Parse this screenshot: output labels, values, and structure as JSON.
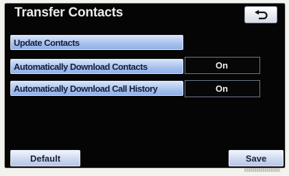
{
  "screen": {
    "title": "Transfer Contacts"
  },
  "header": {
    "back_icon": "return-arrow-icon"
  },
  "settings": {
    "update_label": "Update Contacts",
    "auto_contacts_label": "Automatically Download Contacts",
    "auto_contacts_value": "On",
    "auto_history_label": "Automatically Download Call History",
    "auto_history_value": "On"
  },
  "footer": {
    "default_label": "Default",
    "save_label": "Save"
  },
  "colors": {
    "screen_background": "#050505",
    "button_blue": "#a9c2ef",
    "text_light": "#ececec"
  }
}
